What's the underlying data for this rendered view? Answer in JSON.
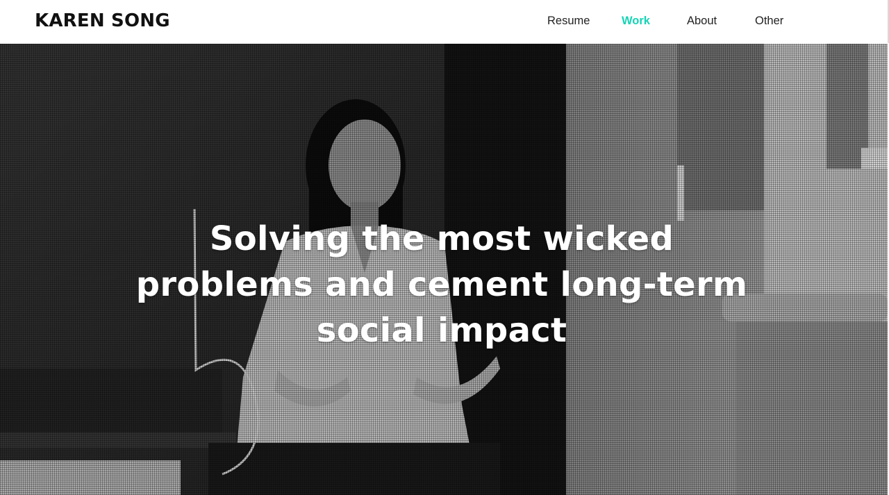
{
  "brand": {
    "name": "KAREN SONG"
  },
  "nav": {
    "items": [
      {
        "label": "Resume",
        "active": false
      },
      {
        "label": "Work",
        "active": true
      },
      {
        "label": "About",
        "active": false
      },
      {
        "label": "Other",
        "active": false
      }
    ]
  },
  "hero": {
    "headline": "Solving the most wicked problems and cement long-term social impact"
  },
  "colors": {
    "accent": "#14d4b6",
    "nav_text": "#222222",
    "headline": "#ffffff"
  }
}
